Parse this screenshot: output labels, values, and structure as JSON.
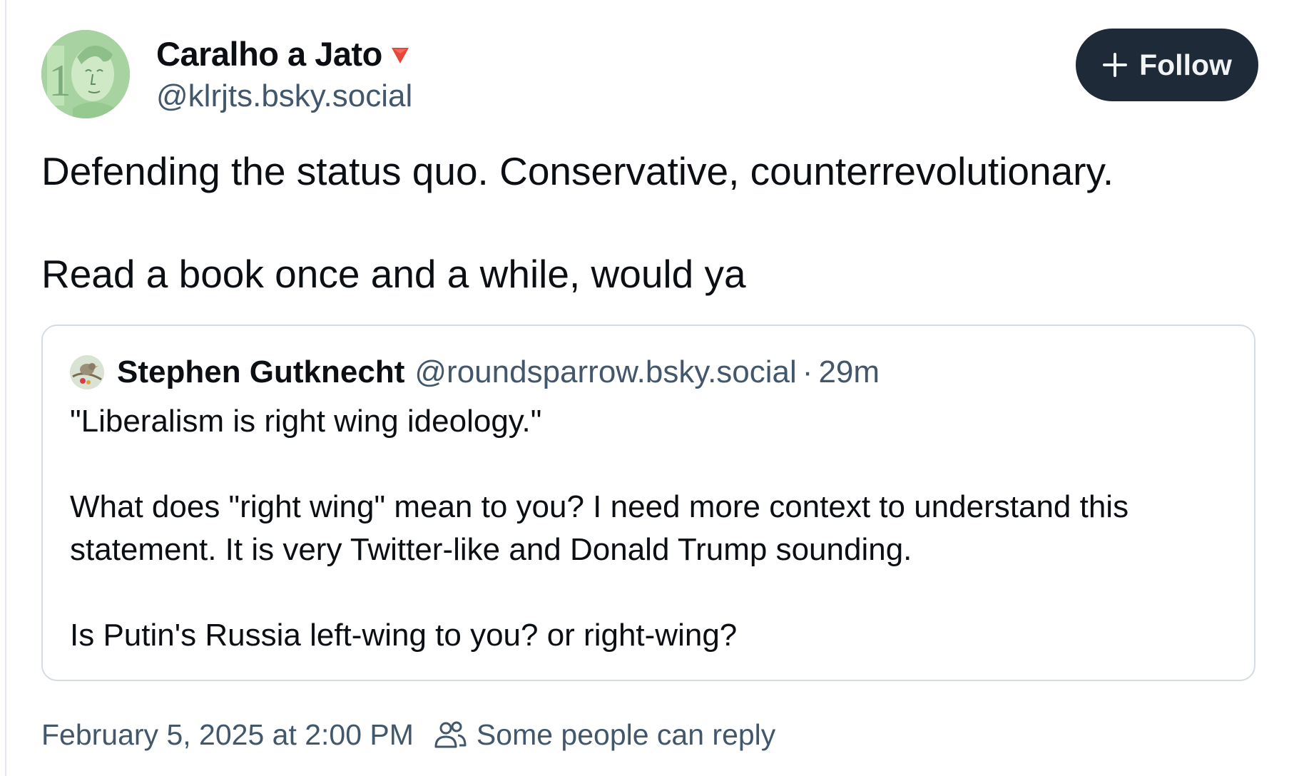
{
  "post": {
    "author": {
      "display_name": "Caralho a Jato",
      "handle": "@klrjts.bsky.social",
      "avatar_icon": "banknote-portrait-avatar",
      "badge_icon": "red-triangle-down-icon"
    },
    "follow_button": {
      "icon": "plus-icon",
      "label": "Follow"
    },
    "text": "Defending the status quo. Conservative, counterrevolutionary.\n\nRead a book once and a while, would ya",
    "quote": {
      "author": {
        "display_name": "Stephen Gutknecht",
        "handle": "@roundsparrow.bsky.social",
        "avatar_icon": "bird-avatar"
      },
      "separator": "·",
      "time": "29m",
      "text": "\"Liberalism is right wing ideology.\"\n\nWhat does \"right wing\" mean to you? I need more context to understand this statement. It is very Twitter-like and Donald Trump sounding.\n\nIs Putin's Russia left-wing to you? or right-wing?"
    },
    "footer": {
      "timestamp": "February 5, 2025 at 2:00 PM",
      "reply_icon": "people-icon",
      "reply_setting": "Some people can reply"
    }
  },
  "colors": {
    "text": "#0b0f14",
    "muted": "#42576c",
    "button_bg": "#1f2a38",
    "button_text": "#f1f3f5",
    "border": "#d4dbe2",
    "badge": "#e8463a"
  }
}
